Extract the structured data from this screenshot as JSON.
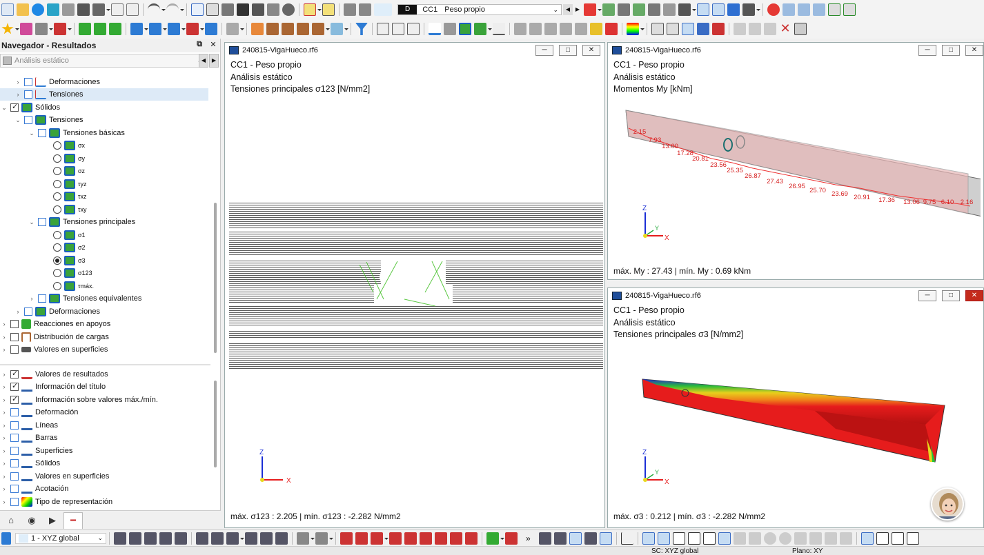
{
  "toolbar": {
    "load_case_code": "D",
    "load_case_id": "CC1",
    "load_case_name": "Peso propio"
  },
  "navigator": {
    "title": "Navegador - Resultados",
    "combo": "Análisis estático",
    "tree": [
      {
        "label": "Deformaciones"
      },
      {
        "label": "Tensiones"
      },
      {
        "label": "Sólidos"
      },
      {
        "label": "Tensiones"
      },
      {
        "label": "Tensiones básicas"
      },
      {
        "label": "σx"
      },
      {
        "label": "σy"
      },
      {
        "label": "σz"
      },
      {
        "label": "τyz"
      },
      {
        "label": "τxz"
      },
      {
        "label": "τxy"
      },
      {
        "label": "Tensiones principales"
      },
      {
        "label": "σ1"
      },
      {
        "label": "σ2"
      },
      {
        "label": "σ3"
      },
      {
        "label": "σ123"
      },
      {
        "label": "τmáx."
      },
      {
        "label": "Tensiones equivalentes"
      },
      {
        "label": "Deformaciones"
      },
      {
        "label": "Reacciones en apoyos"
      },
      {
        "label": "Distribución de cargas"
      },
      {
        "label": "Valores en superficies"
      }
    ],
    "display": [
      {
        "label": "Valores de resultados"
      },
      {
        "label": "Información del título"
      },
      {
        "label": "Información sobre valores máx./mín."
      },
      {
        "label": "Deformación"
      },
      {
        "label": "Líneas"
      },
      {
        "label": "Barras"
      },
      {
        "label": "Superficies"
      },
      {
        "label": "Sólidos"
      },
      {
        "label": "Valores en superficies"
      },
      {
        "label": "Acotación"
      },
      {
        "label": "Tipo de representación"
      }
    ]
  },
  "windows": [
    {
      "title": "240815-VigaHueco.rf6",
      "line1": "CC1 - Peso propio",
      "line2": "Análisis estático",
      "line3": "Tensiones principales σ123 [N/mm2]",
      "footer": "máx. σ123 : 2.205 | mín. σ123 : -2.282 N/mm2"
    },
    {
      "title": "240815-VigaHueco.rf6",
      "line1": "CC1 - Peso propio",
      "line2": "Análisis estático",
      "line3": "Momentos My [kNm]",
      "footer": "máx. My : 27.43 | mín. My : 0.69 kNm",
      "labels": [
        "2.15",
        "7.93",
        "13.00",
        "17.28",
        "20.81",
        "23.56",
        "25.35",
        "26.87",
        "27.43",
        "26.95",
        "25.70",
        "23.69",
        "20.91",
        "17.36",
        "13.06",
        "9.75",
        "6.10",
        "2.16"
      ]
    },
    {
      "title": "240815-VigaHueco.rf6",
      "line1": "CC1 - Peso propio",
      "line2": "Análisis estático",
      "line3": "Tensiones principales σ3 [N/mm2]",
      "footer": "máx. σ3 : 0.212 | mín. σ3 : -2.282 N/mm2"
    }
  ],
  "axes": {
    "x": "X",
    "y": "Y",
    "z": "Z"
  },
  "bottom": {
    "view_combo": "1 - XYZ global",
    "status_sc": "SC: XYZ global",
    "status_plane": "Plano: XY"
  }
}
